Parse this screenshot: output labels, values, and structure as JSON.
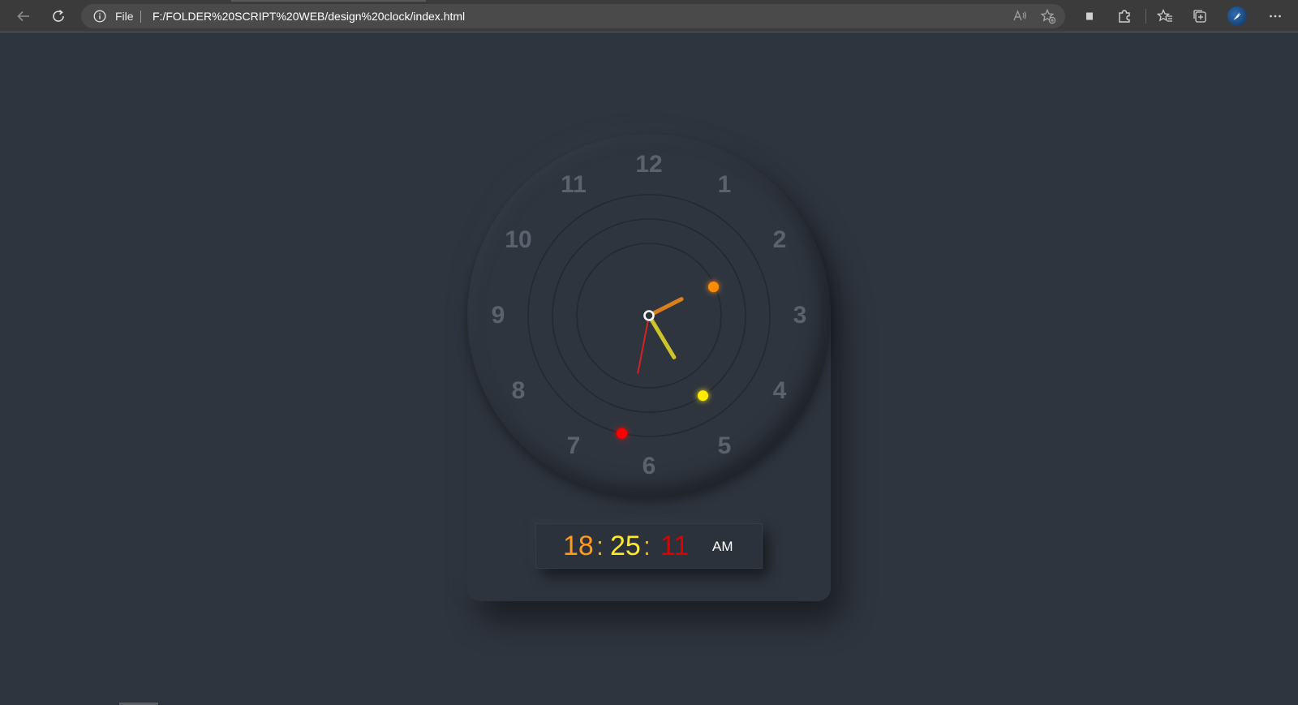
{
  "browser": {
    "address_scheme": "File",
    "url": "F:/FOLDER%20SCRIPT%20WEB/design%20clock/index.html",
    "icons": {
      "back": "back-arrow-icon",
      "refresh": "refresh-icon",
      "info": "info-icon",
      "read_aloud": "read-aloud-icon",
      "add_favorite": "add-favorite-icon",
      "extension_stop": "stop-square-icon",
      "extensions": "puzzle-icon",
      "favorites": "favorites-icon",
      "collections": "collections-icon",
      "profile": "profile-icon",
      "more": "more-icon"
    }
  },
  "clock": {
    "numerals": [
      "12",
      "1",
      "2",
      "3",
      "4",
      "5",
      "6",
      "7",
      "8",
      "9",
      "10",
      "11"
    ],
    "time": {
      "hours": 6,
      "minutes": 25,
      "seconds": 11
    },
    "colors": {
      "hour": "#ff8c00",
      "minute": "#ffea00",
      "second": "#ff0000",
      "hour_hand": "#d97f1e",
      "minute_hand": "#cdc42a",
      "second_hand": "#d42222",
      "numeral": "#5b626d",
      "background": "#2f353f"
    }
  },
  "digital": {
    "hours": "18",
    "minutes": "25",
    "seconds": "11",
    "separator": ":",
    "ampm": "AM",
    "colors": {
      "hours": "#ff9a1c",
      "minutes": "#ffe829",
      "seconds": "#e00000"
    }
  }
}
